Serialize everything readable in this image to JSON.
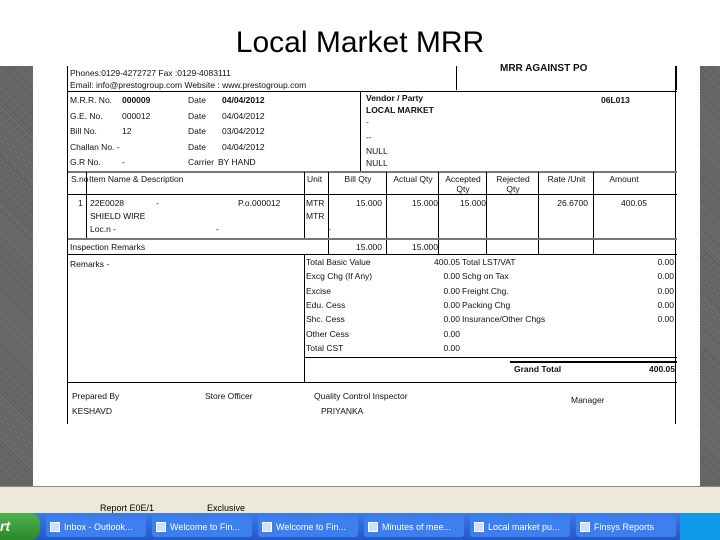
{
  "slide_title": "Local Market MRR",
  "header": {
    "phones": "Phones:0129-4272727 Fax :0129-4083111",
    "email": "Email: info@prestogroup.com  Website : www.prestogroup.com",
    "doc_type": "MRR AGAINST PO"
  },
  "info": [
    {
      "label": "M.R.R. No.",
      "value": "000009",
      "date_label": "Date",
      "date": "04/04/2012"
    },
    {
      "label": "G.E. No.",
      "value": "000012",
      "date_label": "Date",
      "date": "04/04/2012"
    },
    {
      "label": "Bill No.",
      "value": "12",
      "date_label": "Date",
      "date": "03/04/2012"
    },
    {
      "label": "Challan No. -",
      "value": "",
      "date_label": "Date",
      "date": "04/04/2012"
    },
    {
      "label": "G.R No.",
      "value": "-",
      "date_label": "Carrier",
      "date": "BY HAND"
    }
  ],
  "vendor": {
    "label": "Vendor / Party",
    "code": "06L013",
    "name": "LOCAL MARKET",
    "lines": [
      "-",
      "--",
      "NULL",
      "NULL"
    ]
  },
  "columns": [
    "S.no",
    "Item Name & Description",
    "Unit",
    "Bill Qty",
    "Actual Qty",
    "Accepted Qty",
    "Rejected Qty",
    "Rate /Unit",
    "Amount"
  ],
  "item": {
    "sno": "1",
    "code": "22E0028",
    "dash": "-",
    "po": "P.o.000012",
    "name": "SHIELD WIRE",
    "loc": "Loc.n -",
    "loc_dash": "-",
    "unit1": "MTR",
    "unit2": "MTR",
    "unit_dash": "-",
    "bill_qty": "15.000",
    "actual_qty": "15.000",
    "accepted_qty": "15.000",
    "rejected_qty": "",
    "rate": "26.6700",
    "amount": "400.05"
  },
  "inspection": {
    "label": "Inspection Remarks",
    "bill_total": "15.000",
    "actual_total": "15.000"
  },
  "remarks_label": "Remarks -",
  "charges_left": [
    {
      "label": "Total Basic Value",
      "value": "400.05"
    },
    {
      "label": "Excg Chg (If Any)",
      "value": "0.00"
    },
    {
      "label": "Excise",
      "value": "0.00"
    },
    {
      "label": "Edu. Cess",
      "value": "0.00"
    },
    {
      "label": "Shc. Cess",
      "value": "0.00"
    },
    {
      "label": "Other Cess",
      "value": "0.00"
    },
    {
      "label": "Total CST",
      "value": "0.00"
    }
  ],
  "charges_right": [
    {
      "label": "Total LST/VAT",
      "value": "0.00"
    },
    {
      "label": "Schg on Tax",
      "value": "0.00"
    },
    {
      "label": "Freight Chg.",
      "value": "0.00"
    },
    {
      "label": "Packing Chg",
      "value": "0.00"
    },
    {
      "label": "Insurance/Other Chgs",
      "value": "0.00"
    }
  ],
  "grand_total": {
    "label": "Grand Total",
    "value": "400.05"
  },
  "signatures": {
    "prepared_by": "Prepared By",
    "prepared_name": "KESHAVD",
    "store": "Store Officer",
    "qc": "Quality Control Inspector",
    "qc_name": "PRIYANKA",
    "manager": "Manager"
  },
  "status": {
    "report": "Report E0E/1",
    "mode": "Exclusive"
  },
  "taskbar": {
    "start": "rt",
    "items": [
      "Inbox - Outlook...",
      "Welcome to Fin...",
      "Welcome to Fin...",
      "Minutes of mee...",
      "Local market pu...",
      "Finsys Reports"
    ]
  }
}
